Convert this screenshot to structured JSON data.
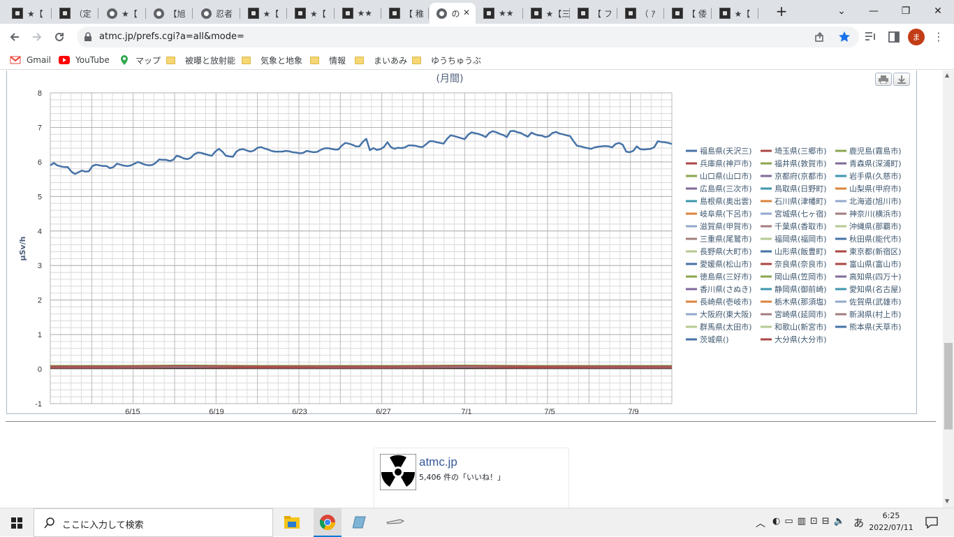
{
  "browser": {
    "tabs": [
      {
        "label": "★【",
        "icon": "site-icon"
      },
      {
        "label": "（定",
        "icon": "site-icon"
      },
      {
        "label": "★【",
        "icon": "globe-icon"
      },
      {
        "label": "【旭",
        "icon": "globe-icon"
      },
      {
        "label": "忍者",
        "icon": "globe-icon"
      },
      {
        "label": "★【",
        "icon": "site-icon"
      },
      {
        "label": "★【",
        "icon": "site-icon"
      },
      {
        "label": "★★",
        "icon": "site-icon"
      },
      {
        "label": "【 稚",
        "icon": "site-icon"
      },
      {
        "label": "の",
        "icon": "globe-icon",
        "active": true
      },
      {
        "label": "★★",
        "icon": "site-icon"
      },
      {
        "label": "★【三",
        "icon": "site-icon"
      },
      {
        "label": "【 フ",
        "icon": "site-icon"
      },
      {
        "label": "（ ｱ",
        "icon": "site-icon"
      },
      {
        "label": "【 倭",
        "icon": "site-icon"
      },
      {
        "label": "★【",
        "icon": "site-icon"
      }
    ],
    "new_tab": "+",
    "url": "atmc.jp/prefs.cgi?a=all&mode=",
    "profile_initial": "ま",
    "bookmarks": [
      {
        "label": "Gmail",
        "icon": "gmail-icon"
      },
      {
        "label": "YouTube",
        "icon": "youtube-icon"
      },
      {
        "label": "マップ",
        "icon": "maps-icon"
      },
      {
        "label": "被曝と放射能",
        "icon": "folder-icon"
      },
      {
        "label": "気象と地象",
        "icon": "folder-icon"
      },
      {
        "label": "情報",
        "icon": "folder-icon"
      },
      {
        "label": "まいあみ",
        "icon": "folder-icon"
      },
      {
        "label": "ゆうちゅうぶ",
        "icon": "folder-icon"
      }
    ]
  },
  "chart_data": {
    "type": "line",
    "title": "(月間)",
    "ylabel": "µSv/h",
    "ylim": [
      -1,
      8
    ],
    "yticks": [
      -1,
      0,
      1,
      2,
      3,
      4,
      5,
      6,
      7,
      8
    ],
    "x_tick_labels": [
      "6/15",
      "6/19",
      "6/23",
      "6/27",
      "7/1",
      "7/5",
      "7/9"
    ],
    "grid": true,
    "legend_position": "right",
    "legend": [
      {
        "name": "福島県(天沢三)",
        "color": "#4572a7"
      },
      {
        "name": "埼玉県(三郷市)",
        "color": "#aa4643"
      },
      {
        "name": "鹿児島(霧島市)",
        "color": "#89a54e"
      },
      {
        "name": "兵庫県(神戸市)",
        "color": "#aa4643"
      },
      {
        "name": "福井県(敦賀市)",
        "color": "#89a54e"
      },
      {
        "name": "青森県(深浦町)",
        "color": "#80699b"
      },
      {
        "name": "山口県(山口市)",
        "color": "#89a54e"
      },
      {
        "name": "京都府(京都市)",
        "color": "#80699b"
      },
      {
        "name": "岩手県(久慈市)",
        "color": "#3d96ae"
      },
      {
        "name": "広島県(三次市)",
        "color": "#80699b"
      },
      {
        "name": "鳥取県(日野町)",
        "color": "#3d96ae"
      },
      {
        "name": "山梨県(甲府市)",
        "color": "#db843d"
      },
      {
        "name": "島根県(奥出雲)",
        "color": "#3d96ae"
      },
      {
        "name": "石川県(津幡町)",
        "color": "#db843d"
      },
      {
        "name": "北海道(旭川市)",
        "color": "#92a8cd"
      },
      {
        "name": "岐阜県(下呂市)",
        "color": "#db843d"
      },
      {
        "name": "宮城県(七ヶ宿)",
        "color": "#92a8cd"
      },
      {
        "name": "神奈川(横浜市)",
        "color": "#a47d7c"
      },
      {
        "name": "滋賀県(甲賀市)",
        "color": "#92a8cd"
      },
      {
        "name": "千葉県(香取市)",
        "color": "#a47d7c"
      },
      {
        "name": "沖縄県(那覇市)",
        "color": "#b5ca92"
      },
      {
        "name": "三重県(尾鷲市)",
        "color": "#a47d7c"
      },
      {
        "name": "福岡県(福岡市)",
        "color": "#b5ca92"
      },
      {
        "name": "秋田県(能代市)",
        "color": "#4572a7"
      },
      {
        "name": "長野県(大町市)",
        "color": "#b5ca92"
      },
      {
        "name": "山形県(飯豊町)",
        "color": "#4572a7"
      },
      {
        "name": "東京都(新宿区)",
        "color": "#aa4643"
      },
      {
        "name": "愛媛県(松山市)",
        "color": "#4572a7"
      },
      {
        "name": "奈良県(奈良市)",
        "color": "#aa4643"
      },
      {
        "name": "富山県(富山市)",
        "color": "#aa4643"
      },
      {
        "name": "徳島県(三好市)",
        "color": "#89a54e"
      },
      {
        "name": "岡山県(笠岡市)",
        "color": "#89a54e"
      },
      {
        "name": "高知県(四万十)",
        "color": "#80699b"
      },
      {
        "name": "香川県(さぬき)",
        "color": "#80699b"
      },
      {
        "name": "静岡県(御前崎)",
        "color": "#3d96ae"
      },
      {
        "name": "愛知県(名古屋)",
        "color": "#3d96ae"
      },
      {
        "name": "長崎県(壱岐市)",
        "color": "#db843d"
      },
      {
        "name": "栃木県(那須塩)",
        "color": "#db843d"
      },
      {
        "name": "佐賀県(武雄市)",
        "color": "#92a8cd"
      },
      {
        "name": "大阪府(東大阪)",
        "color": "#92a8cd"
      },
      {
        "name": "宮崎県(延岡市)",
        "color": "#a47d7c"
      },
      {
        "name": "新潟県(村上市)",
        "color": "#a47d7c"
      },
      {
        "name": "群馬県(太田市)",
        "color": "#b5ca92"
      },
      {
        "name": "和歌山(新宮市)",
        "color": "#b5ca92"
      },
      {
        "name": "熊本県(天草市)",
        "color": "#4572a7"
      },
      {
        "name": "茨城県()",
        "color": "#4572a7"
      },
      {
        "name": "大分県(大分市)",
        "color": "#aa4643"
      }
    ],
    "series": [
      {
        "name": "福島県(天沢三)",
        "color": "#4572a7",
        "values": [
          5.9,
          5.97,
          5.9,
          5.87,
          5.85,
          5.85,
          5.72,
          5.65,
          5.7,
          5.75,
          5.72,
          5.73,
          5.88,
          5.92,
          5.9,
          5.88,
          5.88,
          5.82,
          5.85,
          5.95,
          5.92,
          5.89,
          5.88,
          5.9,
          5.95,
          6.0,
          5.96,
          5.92,
          5.9,
          5.91,
          5.97,
          6.07,
          6.06,
          6.06,
          6.03,
          6.06,
          6.18,
          6.15,
          6.1,
          6.08,
          6.12,
          6.22,
          6.27,
          6.26,
          6.23,
          6.2,
          6.18,
          6.3,
          6.38,
          6.3,
          6.18,
          6.16,
          6.15,
          6.3,
          6.36,
          6.37,
          6.33,
          6.3,
          6.33,
          6.41,
          6.43,
          6.39,
          6.36,
          6.32,
          6.3,
          6.3,
          6.3,
          6.32,
          6.31,
          6.28,
          6.27,
          6.25,
          6.26,
          6.32,
          6.3,
          6.28,
          6.29,
          6.35,
          6.39,
          6.4,
          6.38,
          6.36,
          6.36,
          6.47,
          6.55,
          6.53,
          6.5,
          6.45,
          6.45,
          6.58,
          6.67,
          6.34,
          6.4,
          6.35,
          6.37,
          6.43,
          6.57,
          6.43,
          6.38,
          6.41,
          6.4,
          6.42,
          6.48,
          6.48,
          6.47,
          6.44,
          6.43,
          6.51,
          6.6,
          6.6,
          6.57,
          6.55,
          6.53,
          6.67,
          6.77,
          6.75,
          6.72,
          6.69,
          6.66,
          6.79,
          6.86,
          6.83,
          6.81,
          6.77,
          6.72,
          6.84,
          6.89,
          6.86,
          6.81,
          6.78,
          6.72,
          6.89,
          6.9,
          6.86,
          6.84,
          6.78,
          6.73,
          6.85,
          6.8,
          6.77,
          6.76,
          6.72,
          6.75,
          6.84,
          6.87,
          6.82,
          6.8,
          6.77,
          6.75,
          6.6,
          6.47,
          6.45,
          6.42,
          6.4,
          6.38,
          6.42,
          6.44,
          6.45,
          6.46,
          6.45,
          6.42,
          6.52,
          6.55,
          6.5,
          6.3,
          6.28,
          6.32,
          6.45,
          6.37,
          6.36,
          6.37,
          6.38,
          6.43,
          6.6,
          6.58,
          6.57,
          6.55,
          6.52
        ]
      },
      {
        "name": "埼玉県(三郷市)",
        "color": "#aa4643",
        "values": [
          0.08,
          0.08,
          0.09,
          0.08,
          0.08,
          0.08,
          0.09,
          0.08,
          0.08,
          0.08
        ]
      },
      {
        "name": "鹿児島(霧島市)",
        "color": "#89a54e",
        "values": [
          0.1,
          0.1,
          0.11,
          0.1,
          0.1,
          0.1,
          0.11,
          0.1,
          0.1,
          0.1
        ]
      },
      {
        "name": "宮城県(七ヶ宿)",
        "color": "#92a8cd",
        "values": [
          0.07,
          0.07,
          0.07,
          0.08,
          0.07,
          0.07,
          0.07,
          0.08,
          0.07,
          0.07
        ]
      },
      {
        "name": "大分県(大分市)",
        "color": "#aa4643",
        "values": [
          0.04,
          0.04,
          0.05,
          0.04,
          0.04,
          0.04,
          0.05,
          0.04,
          0.04,
          0.04
        ]
      },
      {
        "name": "東京都(新宿区)",
        "color": "#222222",
        "values": [
          0.03,
          0.03,
          0.03,
          0.03,
          0.03,
          0.03,
          0.03,
          0.03,
          0.03,
          0.03
        ]
      }
    ]
  },
  "facebook": {
    "title": "atmc.jp",
    "likes": "5,406 件の「いいね！」"
  },
  "taskbar": {
    "search_placeholder": "ここに入力して検索",
    "time": "6:25",
    "date": "2022/07/11",
    "ime": "あ"
  }
}
